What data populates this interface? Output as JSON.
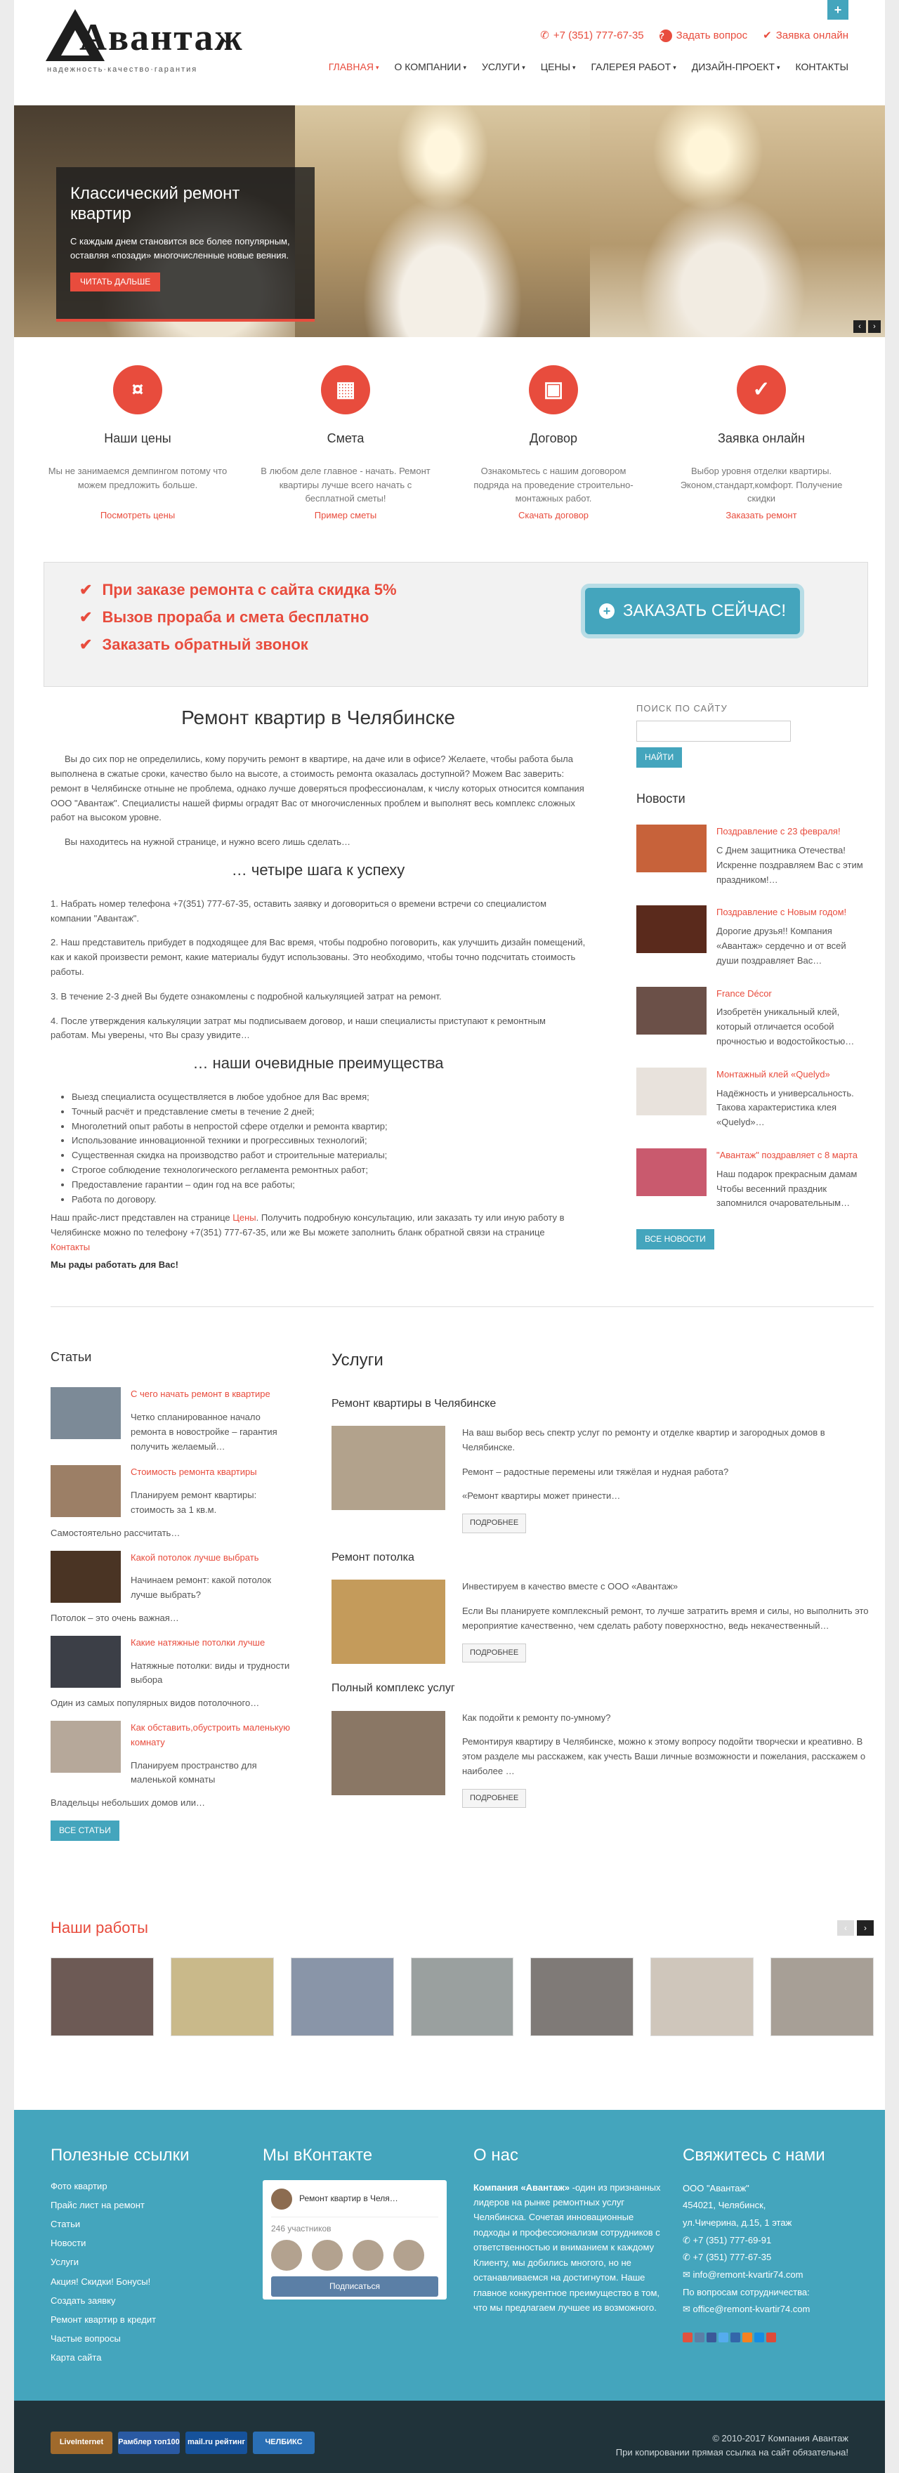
{
  "header": {
    "logo_text": "Авантаж",
    "logo_tagline": "надежность·качество·гарантия",
    "plus_label": "+",
    "phone": "+7 (351) 777-67-35",
    "ask_question": "Задать вопрос",
    "online_request": "Заявка онлайн",
    "nav": [
      "ГЛАВНАЯ",
      "О КОМПАНИИ",
      "УСЛУГИ",
      "ЦЕНЫ",
      "ГАЛЕРЕЯ РАБОТ",
      "ДИЗАЙН-ПРОЕКТ",
      "КОНТАКТЫ"
    ]
  },
  "slider": {
    "title": "Классический ремонт квартир",
    "text": "С каждым днем становится все более популярным, оставляя «позади» многочисленные новые веяния.",
    "button": "ЧИТАТЬ ДАЛЬШЕ",
    "prev": "‹",
    "next": "›"
  },
  "features": [
    {
      "icon": "money-icon",
      "glyph": "¤",
      "title": "Наши цены",
      "text": "Мы не занимаемся демпингом потому что можем предложить больше.",
      "link": "Посмотреть цены"
    },
    {
      "icon": "calendar-icon",
      "glyph": "▦",
      "title": "Смета",
      "text": "В любом деле главное - начать. Ремонт квартиры лучше всего начать с бесплатной сметы!",
      "link": "Пример сметы"
    },
    {
      "icon": "briefcase-icon",
      "glyph": "▣",
      "title": "Договор",
      "text": "Ознакомьтесь с нашим договором подряда на проведение строительно-монтажных работ.",
      "link": "Скачать договор"
    },
    {
      "icon": "check-circle-icon",
      "glyph": "✓",
      "title": "Заявка онлайн",
      "text": "Выбор уровня отделки квартиры. Эконом,стандарт,комфорт. Получение скидки",
      "link": "Заказать ремонт"
    }
  ],
  "promo": {
    "items": [
      "При заказе ремонта с сайта скидка 5%",
      "Вызов прораба и смета бесплатно",
      "Заказать обратный звонок"
    ],
    "order_button": "ЗАКАЗАТЬ СЕЙЧАС!"
  },
  "main": {
    "title": "Ремонт квартир в Челябинске",
    "p1": "Вы до сих пор не определились, кому поручить ремонт в квартире, на даче или в офисе? Желаете, чтобы работа была выполнена в сжатые сроки, качество было на высоте, а стоимость ремонта оказалась доступной? Можем Вас заверить: ремонт в Челябинске отныне не проблема, однако лучше доверяться профессионалам, к числу которых относится компания ООО \"Авантаж\". Специалисты нашей фирмы оградят Вас от многочисленных проблем и выполнят весь комплекс сложных работ на высоком уровне.",
    "p2": "Вы находитесь на нужной странице, и нужно всего лишь сделать…",
    "h2a": "… четыре шага к успеху",
    "steps": [
      "1. Набрать номер телефона +7(351) 777-67-35, оставить заявку и договориться о времени встречи со специалистом компании \"Авантаж\".",
      "2. Наш представитель прибудет в подходящее для Вас время, чтобы подробно поговорить, как улучшить дизайн помещений, как и какой произвести ремонт, какие материалы будут использованы. Это необходимо, чтобы точно подсчитать стоимость работы.",
      "3. В течение 2-3 дней Вы будете ознакомлены с подробной калькуляцией затрат на ремонт.",
      "4. После утверждения калькуляции затрат мы подписываем договор, и наши специалисты приступают к ремонтным работам. Мы уверены, что Вы сразу увидите…"
    ],
    "h2b": "… наши очевидные преимущества",
    "advantages": [
      "Выезд специалиста осуществляется в любое удобное для Вас время;",
      "Точный расчёт и представление сметы в течение 2 дней;",
      "Многолетний опыт работы в непростой сфере отделки и ремонта квартир;",
      "Использование инновационной техники и прогрессивных технологий;",
      "Существенная скидка на производство работ и строительные материалы;",
      "Строгое соблюдение технологического регламента ремонтных работ;",
      "Предоставление гарантии – один год на все работы;",
      "Работа по договору."
    ],
    "pricelist_a": "Наш прайс-лист представлен на странице ",
    "pricelist_link": "Цены",
    "pricelist_b": ". Получить подробную консультацию, или заказать ту или иную работу в Челябинске можно по телефону +7(351) 777-67-35, или же Вы можете заполнить бланк обратной связи на странице ",
    "pricelist_link2": "Контакты",
    "glad": "Мы рады работать для Вас!"
  },
  "sidebar": {
    "search_label": "ПОИСК ПО САЙТУ",
    "search_button": "НАЙТИ",
    "news_title": "Новости",
    "news": [
      {
        "title": "Поздравление с 23 февраля!",
        "lines": "С Днем защитника Отечества! Искренне поздравляем Вас с этим праздником!…",
        "color": "#c7623a"
      },
      {
        "title": "Поздравление с Новым годом!",
        "lines": "Дорогие друзья!! Компания «Авантаж» сердечно и от всей души поздравляет Вас…",
        "color": "#5a2a1c"
      },
      {
        "title": "France Décor",
        "lines": "Изобретён уникальный клей, который отличается особой прочностью и водостойкостью…",
        "color": "#6b5048"
      },
      {
        "title": "Монтажный клей «Quelyd»",
        "lines": "Надёжность и универсальность. Таковa характеристика клея «Quelyd»…",
        "color": "#e8e2dc"
      },
      {
        "title": "\"Авантаж\" поздравляет с 8 марта",
        "lines": "Наш подарок прекрасным дамам Чтобы весенний праздник запомнился очаровательным…",
        "color": "#c95a6e"
      }
    ],
    "all_news": "ВСЕ НОВОСТИ"
  },
  "articles": {
    "title": "Статьи",
    "items": [
      {
        "title": "С чего начать ремонт в квартире",
        "text": "Четко спланированное начало ремонта в новостройке – гарантия получить желаемый…",
        "color": "#7c8a97"
      },
      {
        "title": "Стоимость ремонта квартиры",
        "text": "Планируем ремонт квартиры: стоимость за 1 кв.м.",
        "color": "#9c7f66"
      },
      {
        "title": "Какой потолок лучше выбрать",
        "text": "Начинаем ремонт: какой потолок лучше выбрать?",
        "color": "#4a3424"
      },
      {
        "title": "Какие натяжные потолки лучше",
        "text": "Натяжные потолки: виды и трудности выбора",
        "color": "#3c3f47"
      },
      {
        "title": "Как обставить,обустроить маленькую комнату",
        "text": "Планируем пространство для маленькой комнаты",
        "color": "#b6a89a"
      }
    ],
    "extra": [
      "",
      "Самостоятельно рассчитать…",
      "Потолок – это очень важная…",
      "Один из самых популярных видов потолочного…",
      "Владельцы небольших домов или…"
    ],
    "all": "ВСЕ СТАТЬИ"
  },
  "services": {
    "title": "Услуги",
    "items": [
      {
        "title": "Ремонт квартиры в Челябинске",
        "p1": "На ваш выбор весь спектр услуг по ремонту и отделке квартир и загородных домов в Челябинске.",
        "p2": "Ремонт – радостные перемены или тяжёлая и нудная работа?",
        "p3": "«Ремонт квартиры может принести…",
        "color": "#b2a28c"
      },
      {
        "title": "Ремонт потолка",
        "p1": "Инвестируем в качество вместе с  ООО «Авантаж»",
        "p2": "Если Вы планируете комплексный ремонт, то лучше затратить время и силы, но выполнить это мероприятие качественно, чем сделать работу поверхностно, ведь некачественный…",
        "p3": "",
        "color": "#c49b5b"
      },
      {
        "title": "Полный комплекс услуг",
        "p1": "Как подойти к ремонту по-умному?",
        "p2": "Ремонтируя квартиру в Челябинске, можно к этому вопросу подойти творчески и креативно. В этом разделе мы расскажем, как учесть Ваши личные возможности и пожелания, расскажем о наиболее …",
        "p3": "",
        "color": "#8a7765"
      }
    ],
    "more": "ПОДРОБНЕЕ"
  },
  "works": {
    "title": "Наши работы",
    "colors": [
      "#6d5a55",
      "#c9b98a",
      "#8995a8",
      "#9aa09f",
      "#7f7a77",
      "#cfc6bb",
      "#a79f96"
    ]
  },
  "footer": {
    "links_title": "Полезные ссылки",
    "links": [
      "Фото квартир",
      "Прайс лист на ремонт",
      "Статьи",
      "Новости",
      "Услуги",
      "Акция! Скидки! Бонусы!",
      "Создать заявку",
      "Ремонт квартир в кредит",
      "Частые вопросы",
      "Карта сайта"
    ],
    "vk_title": "Мы вКонтакте",
    "vk_group": "Ремонт квартир в Челя…",
    "vk_count": "246 участников",
    "vk_subscribe": "Подписаться",
    "about_title": "О нас",
    "about_bold": "Компания «Авантаж»",
    "about_text": " -один из признанных лидеров на рынке ремонтных услуг Челябинска. Сочетая инновационные подходы и профессионализм сотрудников с ответственностью и вниманием к каждому Клиенту, мы добились многого, но не останавливаемся на достигнутом. Наше главное конкурентное преимущество в том, что мы предлагаем лучшее из возможного.",
    "contact_title": "Свяжитесь с нами",
    "company": "ООО \"Авантаж\"",
    "address1": "454021, Челябинск,",
    "address2": "ул.Чичерина, д.15, 1 этаж",
    "phone1": "+7 (351) 777-69-91",
    "phone2": "+7 (351) 777-67-35",
    "email1": "info@remont-kvartir74.com",
    "coop": "По вопросам сотрудничества:",
    "email2": "office@remont-kvartir74.com"
  },
  "bottom": {
    "counters": [
      "LiveInternet",
      "Рамблер топ100",
      "mail.ru рейтинг",
      "ЧЕЛБИКС"
    ],
    "copyright": "© 2010-2017 Компания Авантаж",
    "notice": "При копировании прямая ссылка на сайт обязательна!"
  }
}
